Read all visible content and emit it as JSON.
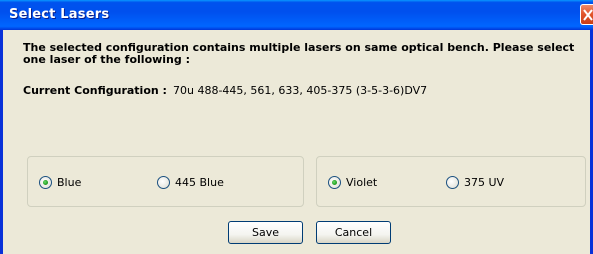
{
  "window": {
    "title": "Select Lasers"
  },
  "message": "The selected configuration contains multiple lasers on same optical bench. Please select one laser of the following :",
  "configuration": {
    "label": "Current Configuration :",
    "value": "70u 488-445, 561, 633, 405-375 (3-5-3-6)DV7"
  },
  "groups": [
    {
      "options": [
        {
          "label": "Blue",
          "checked": true
        },
        {
          "label": "445 Blue",
          "checked": false
        }
      ]
    },
    {
      "options": [
        {
          "label": "Violet",
          "checked": true
        },
        {
          "label": "375 UV",
          "checked": false
        }
      ]
    }
  ],
  "buttons": {
    "save": "Save",
    "cancel": "Cancel"
  },
  "colors": {
    "titlebar": "#0053ee",
    "dialog_bg": "#ece9d8",
    "close_button": "#e2572d",
    "radio_dot": "#21a121"
  }
}
